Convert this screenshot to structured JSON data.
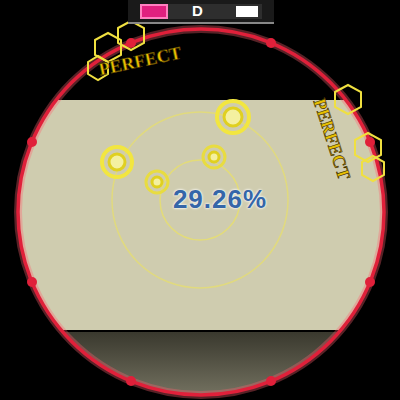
{
  "gauge": {
    "rank": "D",
    "level": 0.23
  },
  "achievement": "29.26%",
  "judgments": [
    {
      "label": "PERFECT"
    },
    {
      "label": "PERFECT"
    }
  ]
}
